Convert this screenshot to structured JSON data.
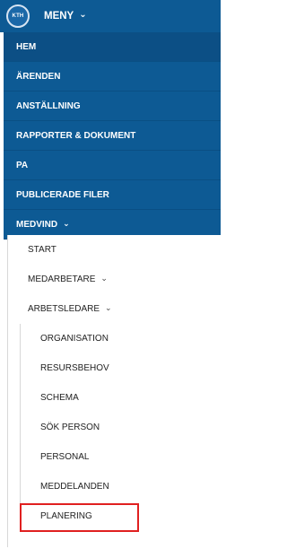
{
  "topbar": {
    "logo_text": "KTH",
    "menu_label": "MENY",
    "chevron": "chevron-down-icon"
  },
  "nav": {
    "items": [
      {
        "label": "HEM"
      },
      {
        "label": "ÄRENDEN"
      },
      {
        "label": "ANSTÄLLNING"
      },
      {
        "label": "RAPPORTER & DOKUMENT"
      },
      {
        "label": "PA"
      },
      {
        "label": "PUBLICERADE FILER"
      },
      {
        "label": "MEDVIND"
      }
    ]
  },
  "medvind": {
    "items": [
      {
        "label": "START"
      },
      {
        "label": "MEDARBETARE"
      },
      {
        "label": "ARBETSLEDARE"
      }
    ],
    "arbetsledare_items": [
      {
        "label": "ORGANISATION"
      },
      {
        "label": "RESURSBEHOV"
      },
      {
        "label": "SCHEMA"
      },
      {
        "label": "SÖK PERSON"
      },
      {
        "label": "PERSONAL"
      },
      {
        "label": "MEDDELANDEN"
      },
      {
        "label": "PLANERING"
      }
    ]
  },
  "colors": {
    "primary": "#0d5a94",
    "highlight": "#e02020"
  }
}
